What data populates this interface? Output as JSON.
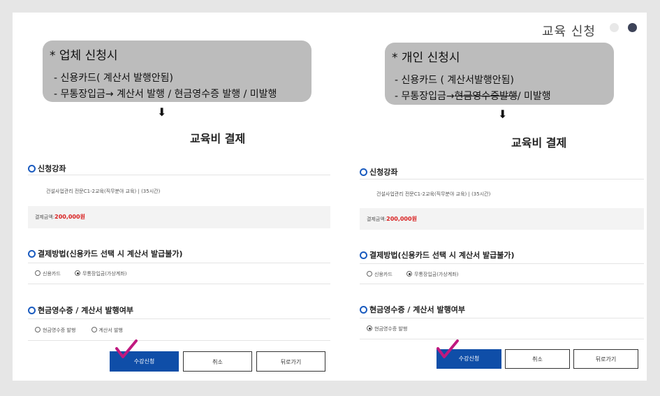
{
  "header": {
    "title": "교육 신청",
    "dot_colors": [
      "#e8e8e8",
      "#3d4358"
    ]
  },
  "left": {
    "note": {
      "title": "* 업체 신청시",
      "line1": "- 신용카드( 계산서 발행안됨)",
      "line2": "- 무통장입금→ 계산서 발행 / 현금영수증 발행 /  미발행"
    },
    "pay_title": "교육비 결제",
    "section_course": "신청강좌",
    "course_name": "건설사업관리 전문C1-2교육(직무분야 교육) | (35시간)",
    "pay_amount_label": "결제금액:",
    "pay_amount": "200,000원",
    "section_method": "결제방법(신용카드 선택 시 계산서 발급불가)",
    "method_card": "신용카드",
    "method_bank": "무통장입금(가상계좌)",
    "section_receipt": "현금영수증 / 계산서 발행여부",
    "receipt_cash": "현금영수증 발행",
    "receipt_invoice": "계산서 발행",
    "btn_apply": "수강신청",
    "btn_cancel": "취소",
    "btn_back": "뒤로가기"
  },
  "right": {
    "note": {
      "title": "* 개인 신청시",
      "line1": "- 신용카드 ( 계산서발행안됨)",
      "line2_prefix": "- 무통장입금→",
      "line2_strike": "현금영수증발행",
      "line2_suffix": "/ 미발행"
    },
    "pay_title": "교육비 결제",
    "section_course": "신청강좌",
    "course_name": "건설사업관리 전문C1-2교육(직무분야 교육) | (35시간)",
    "pay_amount_label": "결제금액:",
    "pay_amount": "200,000원",
    "section_method": "결제방법(신용카드 선택 시 계산서 발급불가)",
    "method_card": "신용카드",
    "method_bank": "무통장입금(가상계좌)",
    "section_receipt": "현금영수증 / 계산서 발행여부",
    "receipt_cash": "현금영수증 발행",
    "btn_apply": "수강신청",
    "btn_cancel": "취소",
    "btn_back": "뒤로가기"
  },
  "colors": {
    "accent_blue": "#0f4ea8",
    "amount_red": "#d81e1e",
    "check_magenta": "#c0197f"
  }
}
